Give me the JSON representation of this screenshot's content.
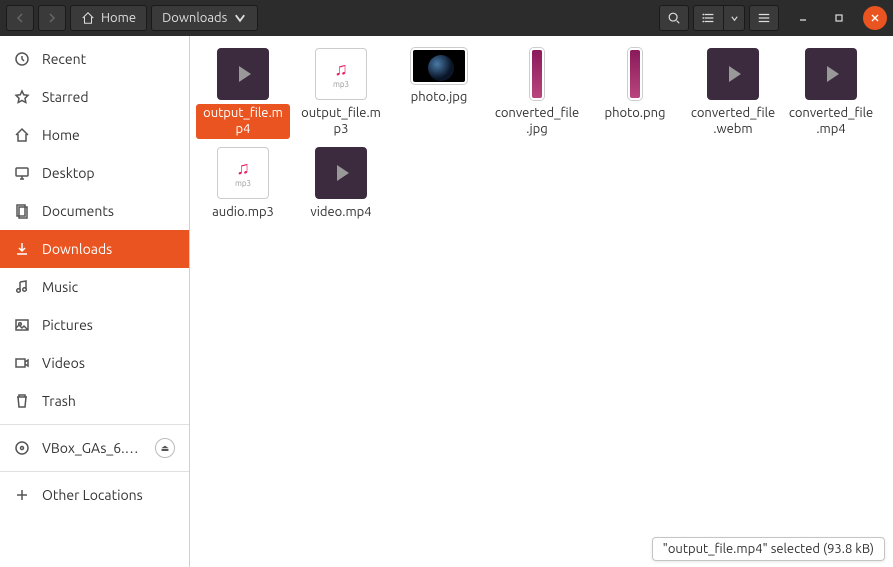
{
  "toolbar": {
    "path": [
      "Home",
      "Downloads"
    ]
  },
  "sidebar": {
    "items": [
      {
        "id": "recent",
        "label": "Recent",
        "icon": "clock"
      },
      {
        "id": "starred",
        "label": "Starred",
        "icon": "star"
      },
      {
        "id": "home",
        "label": "Home",
        "icon": "home"
      },
      {
        "id": "desktop",
        "label": "Desktop",
        "icon": "desktop"
      },
      {
        "id": "documents",
        "label": "Documents",
        "icon": "documents"
      },
      {
        "id": "downloads",
        "label": "Downloads",
        "icon": "downloads",
        "active": true
      },
      {
        "id": "music",
        "label": "Music",
        "icon": "music"
      },
      {
        "id": "pictures",
        "label": "Pictures",
        "icon": "pictures"
      },
      {
        "id": "videos",
        "label": "Videos",
        "icon": "videos"
      },
      {
        "id": "trash",
        "label": "Trash",
        "icon": "trash"
      }
    ],
    "mounts": [
      {
        "id": "vbox",
        "label": "VBox_GAs_6.…",
        "icon": "disc",
        "eject": true
      }
    ],
    "other": {
      "label": "Other Locations",
      "icon": "plus"
    }
  },
  "files": [
    {
      "name": "output_file.mp4",
      "type": "video",
      "selected": true
    },
    {
      "name": "output_file.mp3",
      "type": "audio"
    },
    {
      "name": "photo.jpg",
      "type": "jpg"
    },
    {
      "name": "converted_file.jpg",
      "type": "png"
    },
    {
      "name": "photo.png",
      "type": "png"
    },
    {
      "name": "converted_file.webm",
      "type": "video"
    },
    {
      "name": "converted_file.mp4",
      "type": "video"
    },
    {
      "name": "audio.mp3",
      "type": "audio"
    },
    {
      "name": "video.mp4",
      "type": "video"
    }
  ],
  "status": {
    "selected_name": "output_file.mp4",
    "selected_size": "93.8 kB",
    "text": "\"output_file.mp4\" selected  (93.8 kB)"
  },
  "audio_ext": "mp3"
}
